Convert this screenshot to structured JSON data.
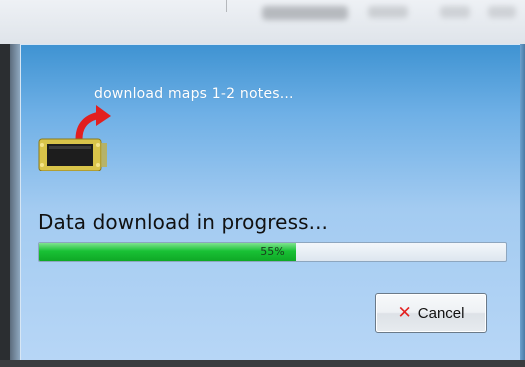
{
  "dialog": {
    "title": "download maps 1-2 notes...",
    "status": "Data download in progress...",
    "progress": {
      "percent": 55,
      "label": "55%"
    },
    "cancel_label": "Cancel",
    "icons": {
      "header": "device-download-icon",
      "cancel": "close-icon"
    }
  },
  "colors": {
    "progress_fill": "#19c135",
    "cancel_x": "#e32222",
    "title_text": "#ffffff"
  }
}
